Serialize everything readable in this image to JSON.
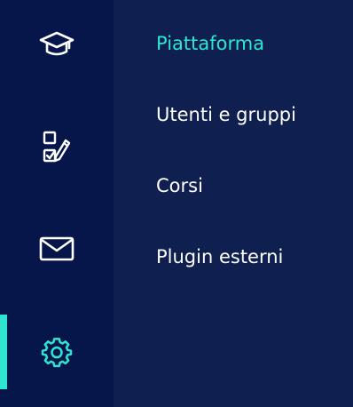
{
  "colors": {
    "rail_bg": "#06164a",
    "panel_bg": "#0f1f4f",
    "accent": "#2ee6d0",
    "text": "#ffffff"
  },
  "rail": {
    "items": [
      {
        "icon": "graduation-cap-icon",
        "active": false
      },
      {
        "icon": "checklist-edit-icon",
        "active": false
      },
      {
        "icon": "mail-icon",
        "active": false
      },
      {
        "icon": "gear-icon",
        "active": true
      }
    ]
  },
  "submenu": {
    "items": [
      {
        "label": "Piattaforma",
        "active": true
      },
      {
        "label": "Utenti e gruppi",
        "active": false
      },
      {
        "label": "Corsi",
        "active": false
      },
      {
        "label": "Plugin esterni",
        "active": false
      }
    ]
  }
}
